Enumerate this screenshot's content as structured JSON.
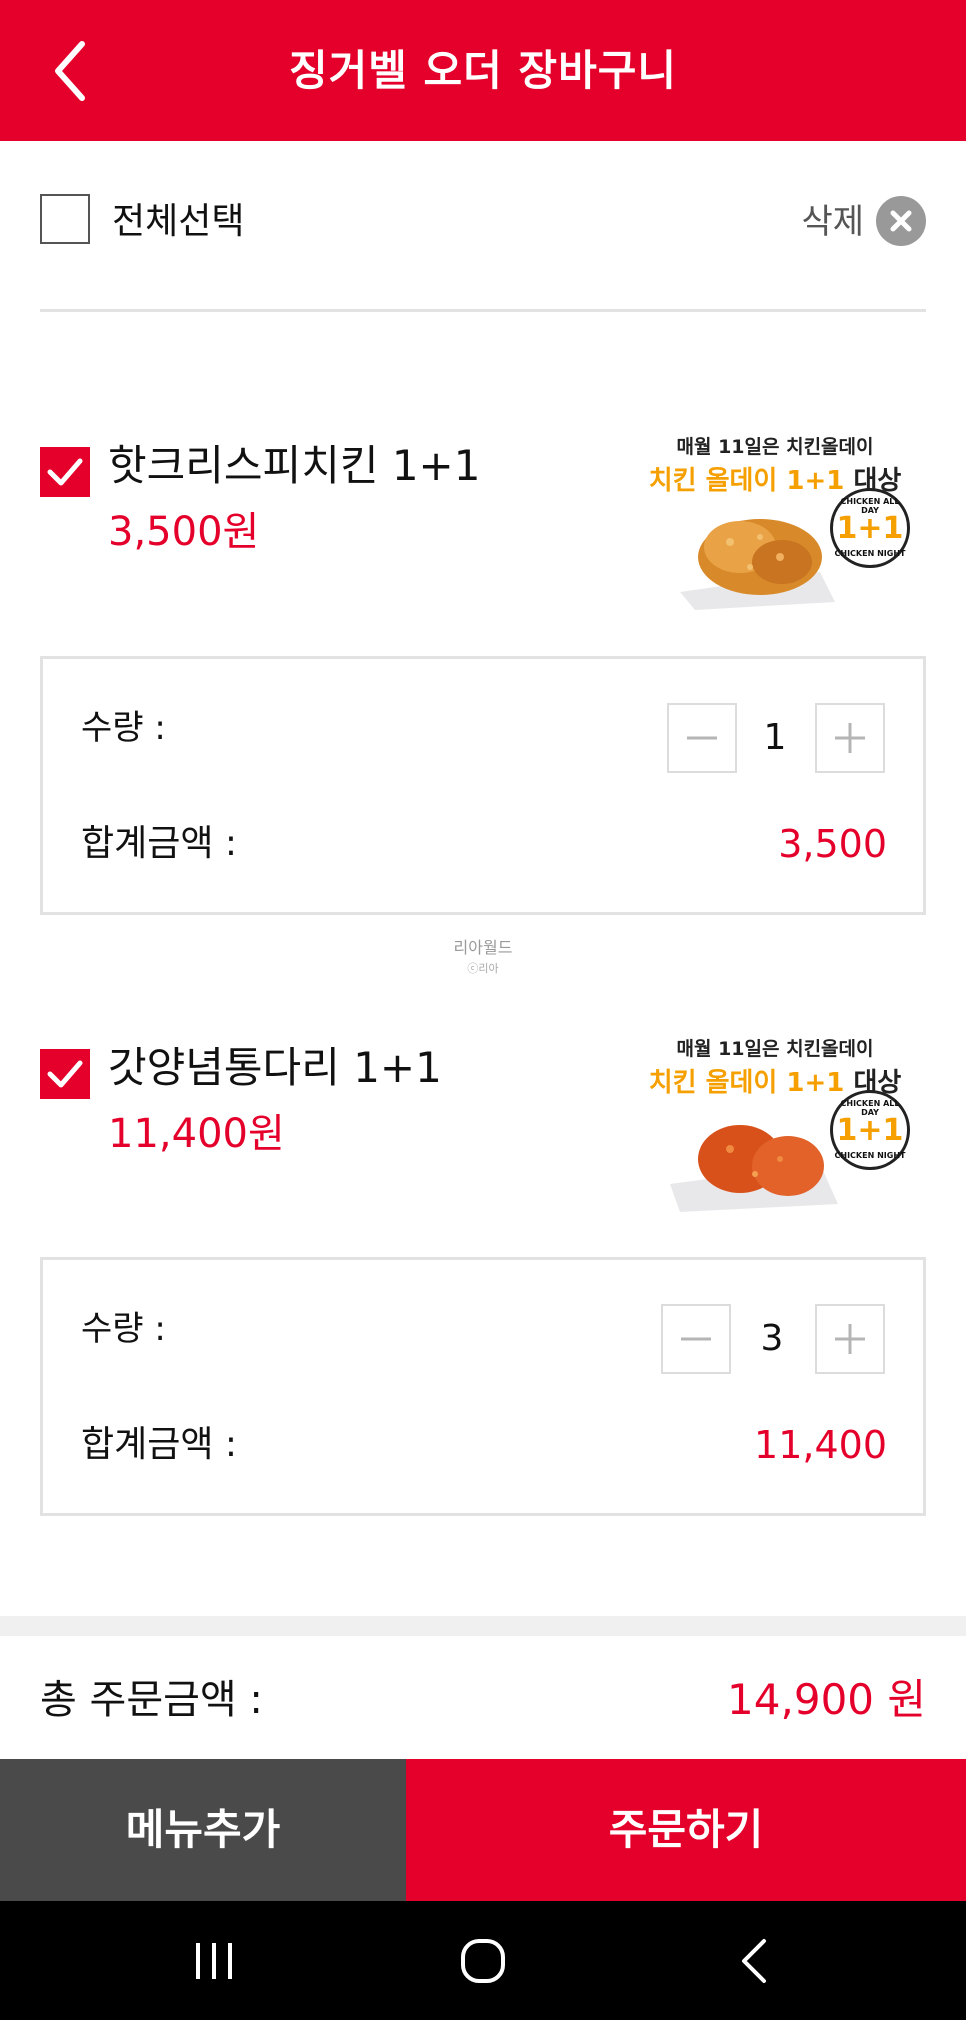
{
  "header": {
    "title": "징거벨 오더 장바구니"
  },
  "select": {
    "all_label": "전체선택",
    "delete_label": "삭제"
  },
  "items": [
    {
      "name": "핫크리스피치킨 1+1",
      "price": "3,500원",
      "promo_line1": "매월 11일은 치킨올데이",
      "promo_line2": "치킨 올데이 1+1",
      "promo_line2_suffix": "대상",
      "badge_top": "CHICKEN ALL DAY",
      "badge_main": "1+1",
      "badge_bottom": "CHICKEN NIGHT",
      "qty_label": "수량 :",
      "qty": "1",
      "sum_label": "합계금액 :",
      "sum": "3,500"
    },
    {
      "name": "갓양념통다리 1+1",
      "price": "11,400원",
      "promo_line1": "매월 11일은 치킨올데이",
      "promo_line2": "치킨 올데이 1+1",
      "promo_line2_suffix": "대상",
      "badge_top": "CHICKEN ALL DAY",
      "badge_main": "1+1",
      "badge_bottom": "CHICKEN NIGHT",
      "qty_label": "수량 :",
      "qty": "3",
      "sum_label": "합계금액 :",
      "sum": "11,400"
    }
  ],
  "watermark": {
    "line1": "리아월드",
    "line2": "ⓒ리아"
  },
  "total": {
    "label": "총 주문금액 :",
    "value": "14,900 원"
  },
  "buttons": {
    "add_menu": "메뉴추가",
    "order": "주문하기"
  },
  "colors": {
    "brand_red": "#e4002b",
    "dark_gray": "#4a4a4a"
  },
  "icons": {
    "back": "chevron-left-icon",
    "delete": "close-circle-icon",
    "check": "check-icon",
    "minus": "minus-icon",
    "plus": "plus-icon"
  }
}
